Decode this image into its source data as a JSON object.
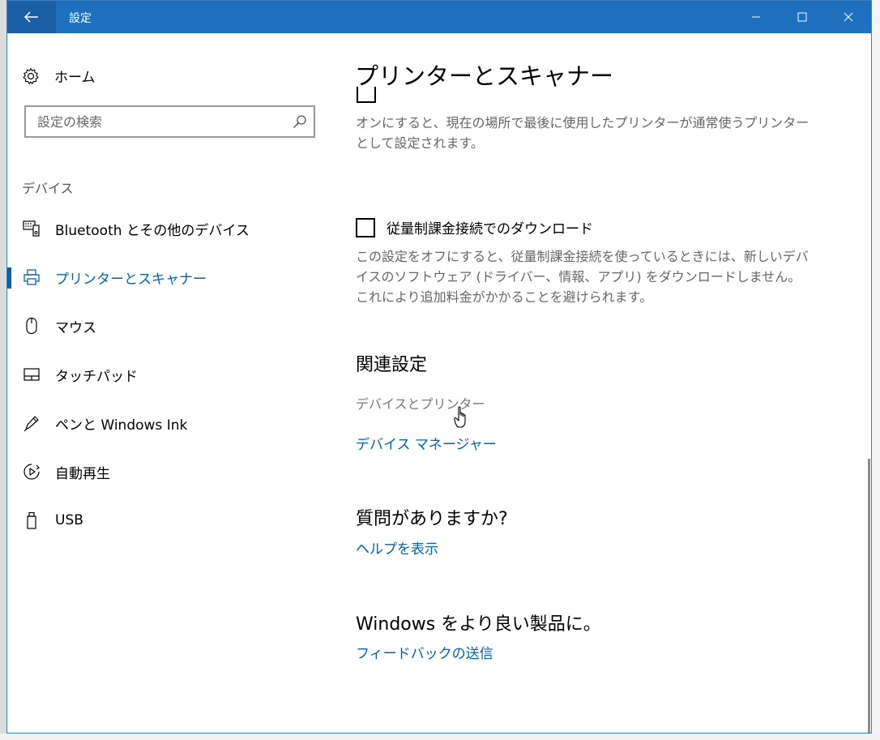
{
  "window": {
    "title": "設定"
  },
  "sidebar": {
    "home_label": "ホーム",
    "search_placeholder": "設定の検索",
    "section_label": "デバイス",
    "items": [
      {
        "label": "Bluetooth とその他のデバイス",
        "icon": "bluetooth-devices-icon"
      },
      {
        "label": "プリンターとスキャナー",
        "icon": "printer-icon",
        "selected": true
      },
      {
        "label": "マウス",
        "icon": "mouse-icon"
      },
      {
        "label": "タッチパッド",
        "icon": "touchpad-icon"
      },
      {
        "label": "ペンと Windows Ink",
        "icon": "pen-icon"
      },
      {
        "label": "自動再生",
        "icon": "autoplay-icon"
      },
      {
        "label": "USB",
        "icon": "usb-icon"
      }
    ]
  },
  "main": {
    "page_title": "プリンターとスキャナー",
    "default_printer_desc": "オンにすると、現在の場所で最後に使用したプリンターが通常使うプリンターとして設定されます。",
    "metered_checkbox_label": "従量制課金接続でのダウンロード",
    "metered_checkbox_checked": false,
    "metered_desc": "この設定をオフにすると、従量制課金接続を使っているときには、新しいデバイスのソフトウェア (ドライバー、情報、アプリ) をダウンロードしません。これにより追加料金がかかることを避けられます。",
    "related_heading": "関連設定",
    "related_links": [
      "デバイスとプリンター",
      "デバイス マネージャー"
    ],
    "question_heading": "質問がありますか?",
    "help_link": "ヘルプを表示",
    "feedback_heading": "Windows をより良い製品に。",
    "feedback_link": "フィードバックの送信"
  },
  "colors": {
    "accent": "#0063b1",
    "titlebar": "#1e6fbe"
  }
}
